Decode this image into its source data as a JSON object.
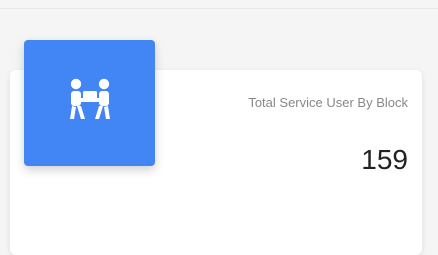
{
  "card": {
    "title": "Total Service User By Block",
    "value": "159",
    "icon": "people-carry-box-icon",
    "accent_color": "#4285f4"
  }
}
